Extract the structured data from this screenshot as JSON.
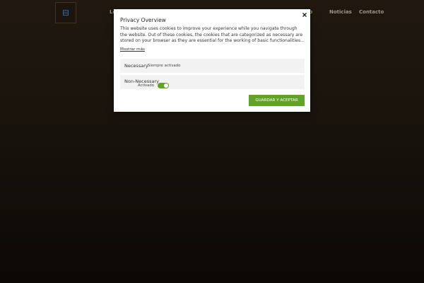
{
  "site_nav": {
    "items": [
      {
        "label": "Lo"
      },
      {
        "label": "ipo"
      },
      {
        "label": "Noticias"
      },
      {
        "label": "Contacto"
      }
    ]
  },
  "cookie_modal": {
    "title": "Privacy Overview",
    "description": "This website uses cookies to improve your experience while you navigate through the website. Out of these cookies, the cookies that are categorized as necessary are stored on your browser as they are essential for the working of basic functionalities...",
    "show_more": "Mostrar más",
    "categories": [
      {
        "label": "Necessary",
        "status": "Siempre activado"
      },
      {
        "label": "Non-Necessary",
        "toggle_label": "Activado",
        "enabled": true
      }
    ],
    "accept_label": "GUARDAR Y ACEPTAR"
  },
  "colors": {
    "accent": "#61a229",
    "background": "#1e170f",
    "modal_bg": "#ffffff",
    "category_bg": "#f2f2f2"
  },
  "icons": {
    "logo": "menu-grid-icon",
    "close": "close-icon"
  }
}
